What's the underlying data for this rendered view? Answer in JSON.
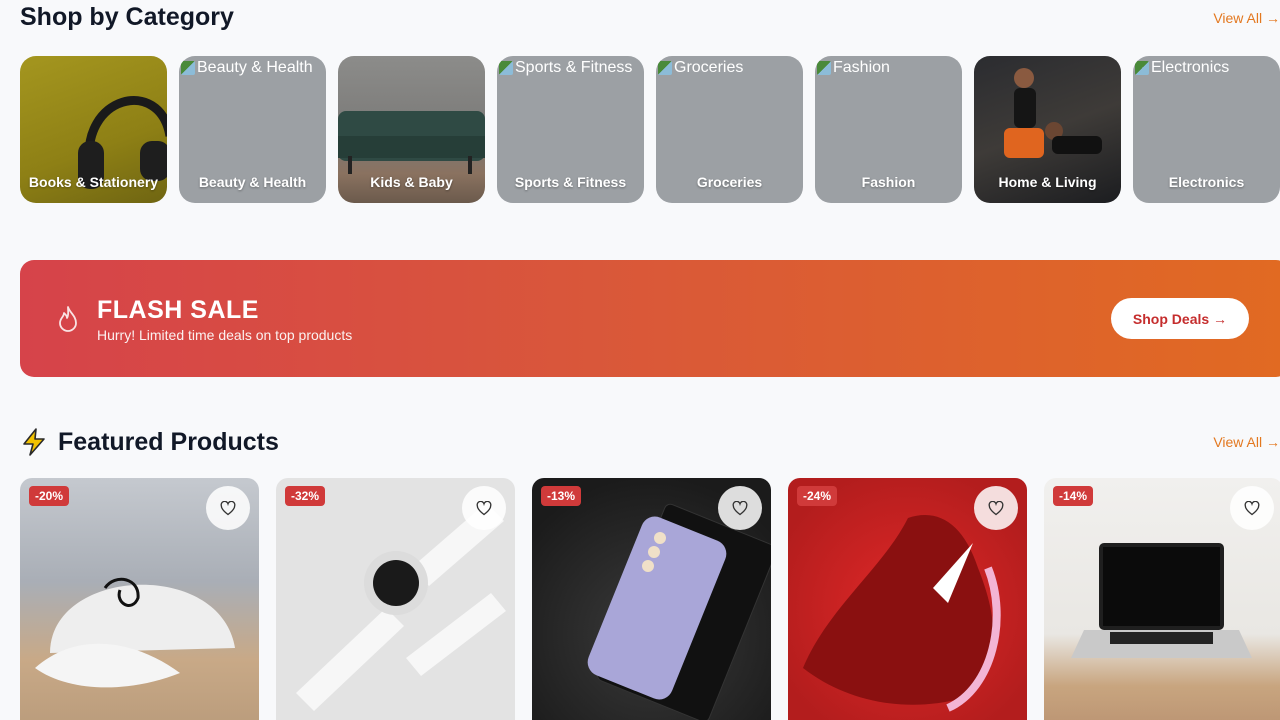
{
  "categories_section": {
    "title": "Shop by Category",
    "view_all": "View All →"
  },
  "categories": [
    {
      "label": "Books & Stationery",
      "alt": ""
    },
    {
      "label": "Beauty & Health",
      "alt": "Beauty & Health"
    },
    {
      "label": "Kids & Baby",
      "alt": ""
    },
    {
      "label": "Sports & Fitness",
      "alt": "Sports & Fitness"
    },
    {
      "label": "Groceries",
      "alt": "Groceries"
    },
    {
      "label": "Fashion",
      "alt": "Fashion"
    },
    {
      "label": "Home & Living",
      "alt": ""
    },
    {
      "label": "Electronics",
      "alt": "Electronics"
    }
  ],
  "flash_sale": {
    "title": "FLASH SALE",
    "subtitle": "Hurry! Limited time deals on top products",
    "button": "Shop Deals →"
  },
  "featured_section": {
    "title": "Featured Products",
    "view_all": "View All →"
  },
  "products": [
    {
      "discount": "-20%"
    },
    {
      "discount": "-32%"
    },
    {
      "discount": "-13%"
    },
    {
      "discount": "-24%"
    },
    {
      "discount": "-14%"
    }
  ],
  "colors": {
    "accent": "#e3781f",
    "flash_start": "#d6434a",
    "flash_end": "#e16a22",
    "discount_badge": "#d03a3a"
  }
}
